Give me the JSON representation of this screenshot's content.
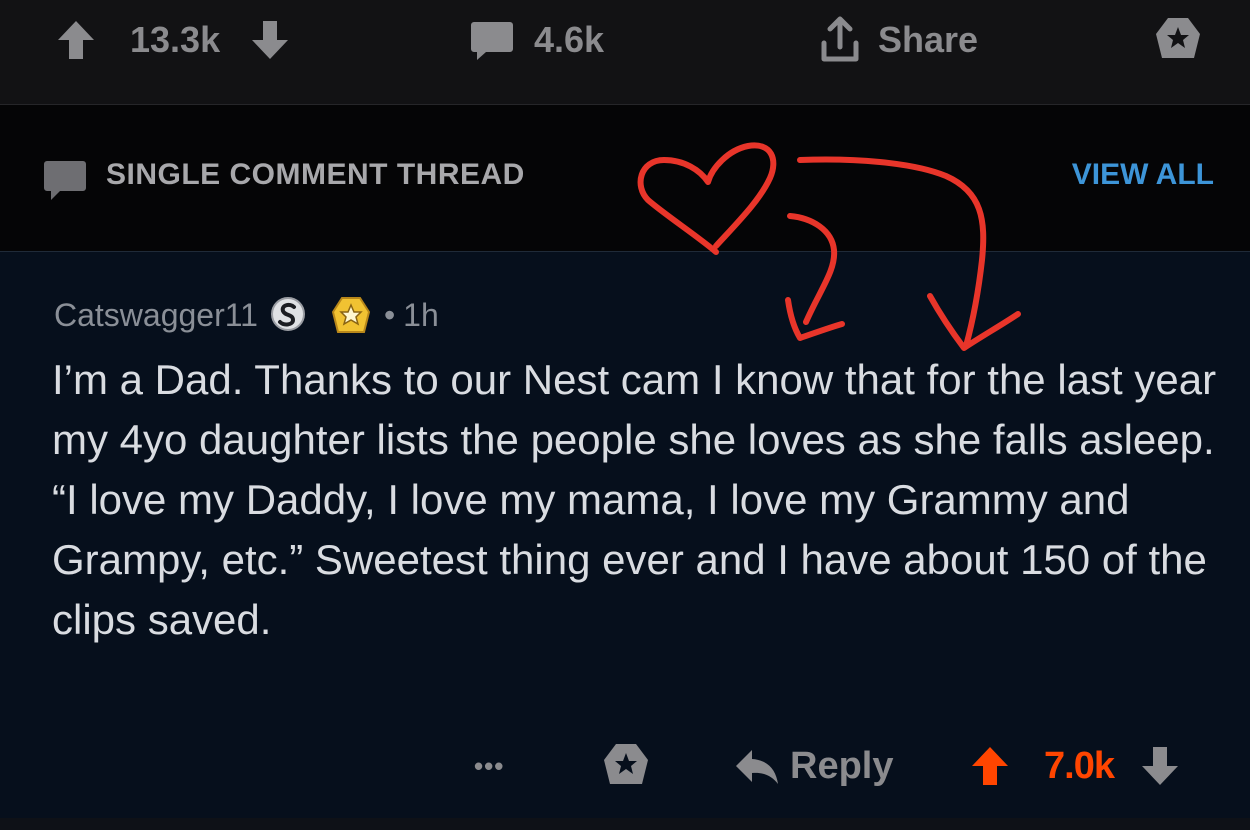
{
  "post_actions": {
    "upvotes": "13.3k",
    "comments": "4.6k",
    "share_label": "Share"
  },
  "thread_header": {
    "label": "SINGLE COMMENT THREAD",
    "view_all_label": "VIEW ALL"
  },
  "comment": {
    "author": "Catswagger11",
    "separator": "•",
    "time": "1h",
    "body": "I’m a Dad. Thanks to our Nest cam I know that for the last year my 4yo daughter lists the people she loves as she falls asleep. “I love my Daddy, I love my mama, I love my Grammy and Grampy, etc.” Sweetest thing ever and I have about 150 of the clips saved.",
    "more_label": "•••",
    "reply_label": "Reply",
    "score": "7.0k"
  },
  "colors": {
    "upvoted": "#ff4500",
    "link_blue": "#3d95d8",
    "annotation_red": "#e8352a"
  },
  "icons": [
    "upvote-icon",
    "downvote-icon",
    "comment-bubble-icon",
    "share-icon",
    "award-icon",
    "speech-badge-icon",
    "award-flair-icon",
    "reply-arrow-icon"
  ]
}
